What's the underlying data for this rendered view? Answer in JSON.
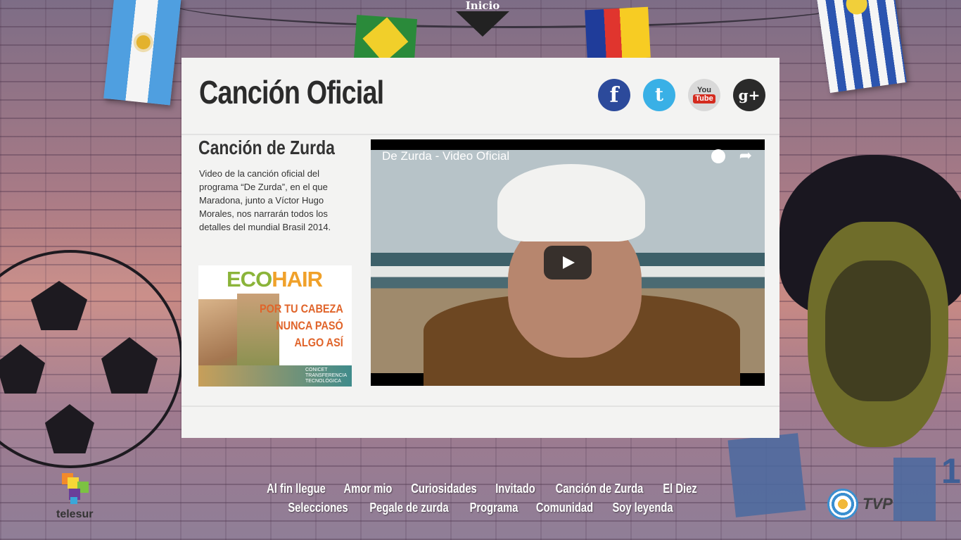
{
  "header": {
    "inicio_label": "Inicio"
  },
  "page": {
    "title": "Canción Oficial"
  },
  "social": {
    "facebook": "f",
    "twitter": "t",
    "youtube_top": "You",
    "youtube_bottom": "Tube",
    "googleplus": "g+"
  },
  "content": {
    "subtitle": "Canción de Zurda",
    "description": "Video de la canción oficial del programa “De Zurda”, en el que Maradona, junto a Víctor Hugo Morales, nos narrarán todos los detalles del mundial Brasil 2014."
  },
  "ad": {
    "brand_eco": "ECO",
    "brand_hair": "HAIR",
    "slogan_1": "POR TU CABEZA",
    "slogan_2": "NUNCA PASÓ",
    "slogan_3": "ALGO ASÍ",
    "footer_text": "CONICET TRANSFERENCIA TECNOLÓGICA"
  },
  "video": {
    "title": "De Zurda - Video Oficial"
  },
  "footer": {
    "logo_left": "telesur",
    "logo_right": "TVP",
    "nav_row1": [
      "Al fin llegue",
      "Amor mio",
      "Curiosidades",
      "Invitado",
      "Canción de Zurda",
      "El Diez"
    ],
    "nav_row2": [
      "Selecciones",
      "Pegale de zurda",
      "Programa",
      "Comunidad",
      "Soy leyenda"
    ]
  },
  "colors": {
    "panel_bg": "#f3f3f2",
    "nav_text": "#ffffff"
  }
}
